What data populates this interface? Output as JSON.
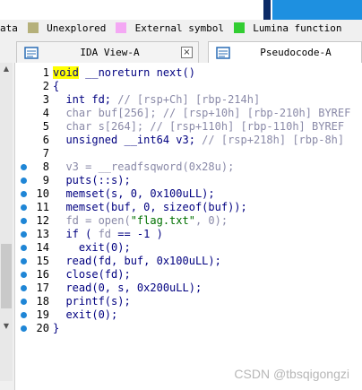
{
  "legend": {
    "cut_text": "ata",
    "items": [
      {
        "label": "Unexplored",
        "color": "#b5b07a"
      },
      {
        "label": "External symbol",
        "color": "#f4a8f4"
      },
      {
        "label": "Lumina function",
        "color": "#32cd32"
      }
    ]
  },
  "tabs": [
    {
      "label": "IDA View-A",
      "close": "×"
    },
    {
      "label": "Pseudocode-A"
    }
  ],
  "code_lines": [
    {
      "n": "1",
      "dot": false,
      "html": "<span class='hl'>void</span> __noreturn next()"
    },
    {
      "n": "2",
      "dot": false,
      "html": "{"
    },
    {
      "n": "3",
      "dot": false,
      "html": "  int fd; <span class='c'>// [rsp+Ch] [rbp-214h]</span>"
    },
    {
      "n": "4",
      "dot": false,
      "html": "  <span class='c'>char buf[256]; // [rsp+10h] [rbp-210h] BYREF</span>"
    },
    {
      "n": "5",
      "dot": false,
      "html": "  <span class='c'>char s[264]; // [rsp+110h] [rbp-110h] BYREF</span>"
    },
    {
      "n": "6",
      "dot": false,
      "html": "  unsigned __int64 v3; <span class='c'>// [rsp+218h] [rbp-8h]</span>"
    },
    {
      "n": "7",
      "dot": false,
      "html": ""
    },
    {
      "n": "8",
      "dot": true,
      "html": "  <span class='c'>v3 = __readfsqword(0x28u);</span>"
    },
    {
      "n": "9",
      "dot": true,
      "html": "  puts(::s);"
    },
    {
      "n": "10",
      "dot": true,
      "html": "  memset(s, 0, 0x100uLL);"
    },
    {
      "n": "11",
      "dot": true,
      "html": "  memset(buf, 0, sizeof(buf));"
    },
    {
      "n": "12",
      "dot": true,
      "html": "  <span class='c'>fd = open(<span class='str'>\"flag.txt\"</span>, 0);</span>"
    },
    {
      "n": "13",
      "dot": true,
      "html": "  if ( <span class='c'>fd</span> == -1 )"
    },
    {
      "n": "14",
      "dot": true,
      "html": "    exit(0);"
    },
    {
      "n": "15",
      "dot": true,
      "html": "  read(fd, buf, 0x100uLL);"
    },
    {
      "n": "16",
      "dot": true,
      "html": "  close(fd);"
    },
    {
      "n": "17",
      "dot": true,
      "html": "  read(0, s, 0x200uLL);"
    },
    {
      "n": "18",
      "dot": true,
      "html": "  printf(s);"
    },
    {
      "n": "19",
      "dot": true,
      "html": "  exit(0);"
    },
    {
      "n": "20",
      "dot": true,
      "html": "}"
    }
  ],
  "watermark": "CSDN @tbsqigongzi"
}
